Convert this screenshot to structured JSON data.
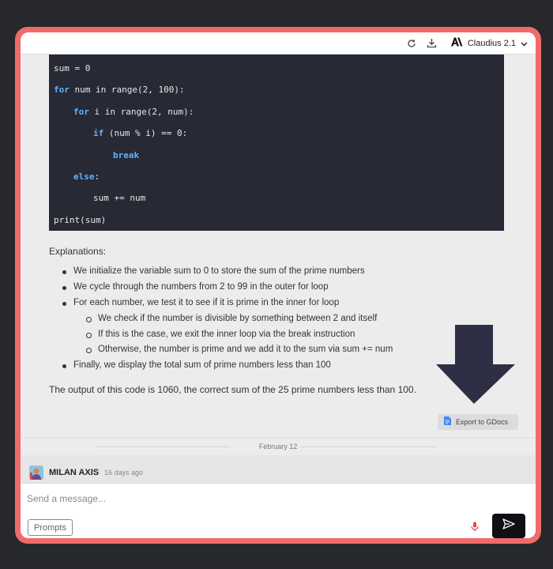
{
  "header": {
    "refresh_icon": "refresh-icon",
    "download_icon": "download-icon",
    "model_name": "Claudius 2.1"
  },
  "code": {
    "lines": [
      {
        "kw": "",
        "text": "sum = 0",
        "indent": 0
      },
      {
        "kw": "for",
        "text": " num in range(2, 100):",
        "indent": 0
      },
      {
        "kw": "for",
        "text": " i in range(2, num):",
        "indent": 1
      },
      {
        "kw": "if",
        "text": " (num % i) == 0:",
        "indent": 2
      },
      {
        "kw": "break",
        "text": "",
        "indent": 3
      },
      {
        "kw": "else",
        "text": ":",
        "indent": 1
      },
      {
        "kw": "",
        "text": "sum += num",
        "indent": 2
      },
      {
        "kw": "",
        "text": "print(sum)",
        "indent": 0
      }
    ]
  },
  "explanations_title": "Explanations:",
  "bullets": [
    {
      "level": 1,
      "text": "We initialize the variable sum to 0 to store the sum of the prime numbers"
    },
    {
      "level": 1,
      "text": "We cycle through the numbers from 2 to 99 in the outer for loop"
    },
    {
      "level": 1,
      "text": "For each number, we test it to see if it is prime in the inner for loop"
    },
    {
      "level": 2,
      "text": "We check if the number is divisible by something between 2 and itself"
    },
    {
      "level": 2,
      "text": "If this is the case, we exit the inner loop via the break instruction"
    },
    {
      "level": 2,
      "text": "Otherwise, the number is prime and we add it to the sum via sum += num"
    },
    {
      "level": 1,
      "text": "Finally, we display the total sum of prime numbers less than 100"
    }
  ],
  "output_text": "The output of this code is 1060, the correct sum of the 25 prime numbers less than 100.",
  "export_label": "Export to GDocs",
  "date_separator": "February 12",
  "next_message": {
    "author": "MILAN AXIS",
    "time_ago": "16 days ago"
  },
  "input": {
    "placeholder": "Send a message...",
    "value": ""
  },
  "prompts_label": "Prompts",
  "colors": {
    "frame": "#f06a6a",
    "code_bg": "#272a35",
    "keyword": "#5fb3ff",
    "arrow": "#2e2f45",
    "mic": "#e04b4b",
    "send_bg": "#0f0f14"
  }
}
